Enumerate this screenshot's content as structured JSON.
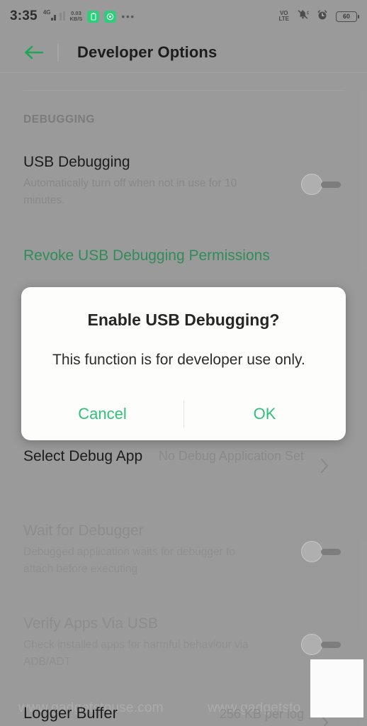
{
  "statusbar": {
    "time": "3:35",
    "network_type": "4G",
    "data_speed_value": "0.03",
    "data_speed_unit": "KB/S",
    "badge_one_icon": "battery-saver-icon",
    "badge_two_icon": "screen-record-icon",
    "overflow_icon": "more-dots-icon",
    "volte_line1": "VO",
    "volte_line2": "LTE",
    "mute_icon": "bell-muted-icon",
    "alarm_icon": "alarm-clock-icon",
    "battery_level": "60"
  },
  "appbar": {
    "back_icon": "back-arrow-icon",
    "title": "Developer Options"
  },
  "list": {
    "section_header": "DEBUGGING",
    "rows": [
      {
        "title": "USB Debugging",
        "subtitle": "Automatically turn off when not in use for 10 minutes.",
        "control": "toggle-off"
      },
      {
        "title": "Revoke USB Debugging Permissions",
        "control": "link"
      },
      {
        "title": "Select Debug App",
        "value": "No Debug Application Set",
        "control": "chevron"
      },
      {
        "title": "Wait for Debugger",
        "subtitle": "Debugged application waits for debugger to attach before executing",
        "control": "toggle-off"
      },
      {
        "title": "Verify Apps Via USB",
        "subtitle": "Check installed apps for harmful behaviour via ADB/ADT",
        "control": "toggle-off"
      },
      {
        "title": "Logger Buffer",
        "value": "256 KB per log",
        "control": "chevron"
      }
    ]
  },
  "watermark": {
    "text_left": "www.gadgetstouse.com",
    "text_right": "www.gadgetsto"
  },
  "dialog": {
    "title": "Enable USB Debugging?",
    "message": "This function is for developer use only.",
    "cancel_label": "Cancel",
    "ok_label": "OK"
  },
  "colors": {
    "accent_green": "#2fc07a",
    "link_green": "#2f8f5b",
    "background": "#9d9d9d"
  }
}
